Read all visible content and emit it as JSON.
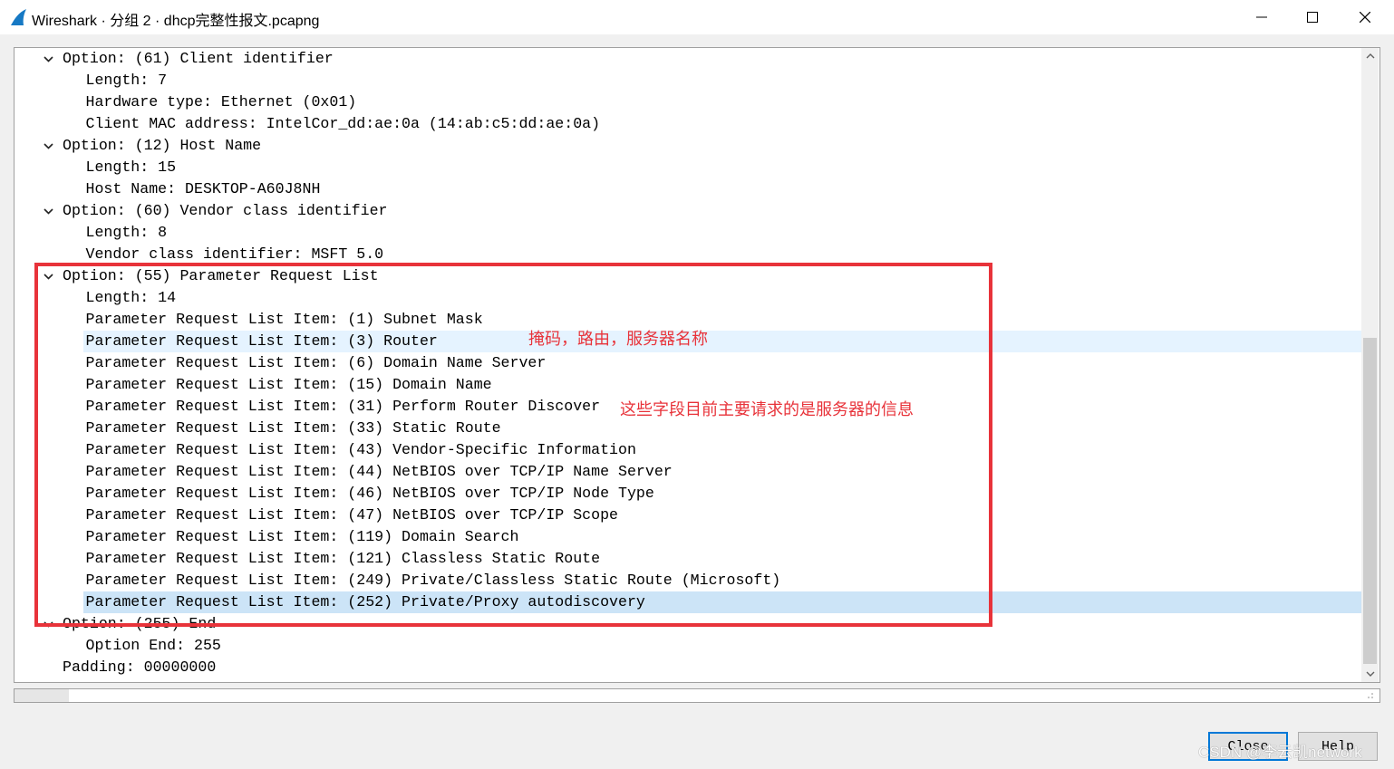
{
  "window": {
    "title": "Wireshark · 分组 2 · dhcp完整性报文.pcapng",
    "icons": [
      "wireshark-fin-icon",
      "minimize-icon",
      "maximize-icon",
      "close-icon"
    ]
  },
  "tree": {
    "rows": [
      {
        "indent": 0,
        "expanded": true,
        "text": "Option: (61) Client identifier"
      },
      {
        "indent": 1,
        "text": "Length: 7"
      },
      {
        "indent": 1,
        "text": "Hardware type: Ethernet (0x01)"
      },
      {
        "indent": 1,
        "text": "Client MAC address: IntelCor_dd:ae:0a (14:ab:c5:dd:ae:0a)"
      },
      {
        "indent": 0,
        "expanded": true,
        "text": "Option: (12) Host Name"
      },
      {
        "indent": 1,
        "text": "Length: 15"
      },
      {
        "indent": 1,
        "text": "Host Name: DESKTOP-A60J8NH"
      },
      {
        "indent": 0,
        "expanded": true,
        "text": "Option: (60) Vendor class identifier"
      },
      {
        "indent": 1,
        "text": "Length: 8"
      },
      {
        "indent": 1,
        "text": "Vendor class identifier: MSFT 5.0"
      },
      {
        "indent": 0,
        "expanded": true,
        "text": "Option: (55) Parameter Request List"
      },
      {
        "indent": 1,
        "text": "Length: 14"
      },
      {
        "indent": 1,
        "text": "Parameter Request List Item: (1) Subnet Mask"
      },
      {
        "indent": 1,
        "text": "Parameter Request List Item: (3) Router",
        "state": "hover"
      },
      {
        "indent": 1,
        "text": "Parameter Request List Item: (6) Domain Name Server"
      },
      {
        "indent": 1,
        "text": "Parameter Request List Item: (15) Domain Name"
      },
      {
        "indent": 1,
        "text": "Parameter Request List Item: (31) Perform Router Discover"
      },
      {
        "indent": 1,
        "text": "Parameter Request List Item: (33) Static Route"
      },
      {
        "indent": 1,
        "text": "Parameter Request List Item: (43) Vendor-Specific Information"
      },
      {
        "indent": 1,
        "text": "Parameter Request List Item: (44) NetBIOS over TCP/IP Name Server"
      },
      {
        "indent": 1,
        "text": "Parameter Request List Item: (46) NetBIOS over TCP/IP Node Type"
      },
      {
        "indent": 1,
        "text": "Parameter Request List Item: (47) NetBIOS over TCP/IP Scope"
      },
      {
        "indent": 1,
        "text": "Parameter Request List Item: (119) Domain Search"
      },
      {
        "indent": 1,
        "text": "Parameter Request List Item: (121) Classless Static Route"
      },
      {
        "indent": 1,
        "text": "Parameter Request List Item: (249) Private/Classless Static Route (Microsoft)"
      },
      {
        "indent": 1,
        "text": "Parameter Request List Item: (252) Private/Proxy autodiscovery",
        "state": "selected"
      },
      {
        "indent": 0,
        "expanded": true,
        "text": "Option: (255) End"
      },
      {
        "indent": 1,
        "text": "Option End: 255"
      },
      {
        "indent": 0,
        "text": "Padding: 00000000"
      }
    ]
  },
  "annotations": {
    "note1": "掩码，路由，服务器名称",
    "note2": "这些字段目前主要请求的是服务器的信息",
    "color": "#e8333a"
  },
  "buttons": {
    "close": "Close",
    "help": "Help"
  },
  "watermark": "CSDN @李云凯network",
  "colors": {
    "selection": "#cce4f7",
    "hover": "#e5f3ff",
    "accent": "#0078d7"
  }
}
